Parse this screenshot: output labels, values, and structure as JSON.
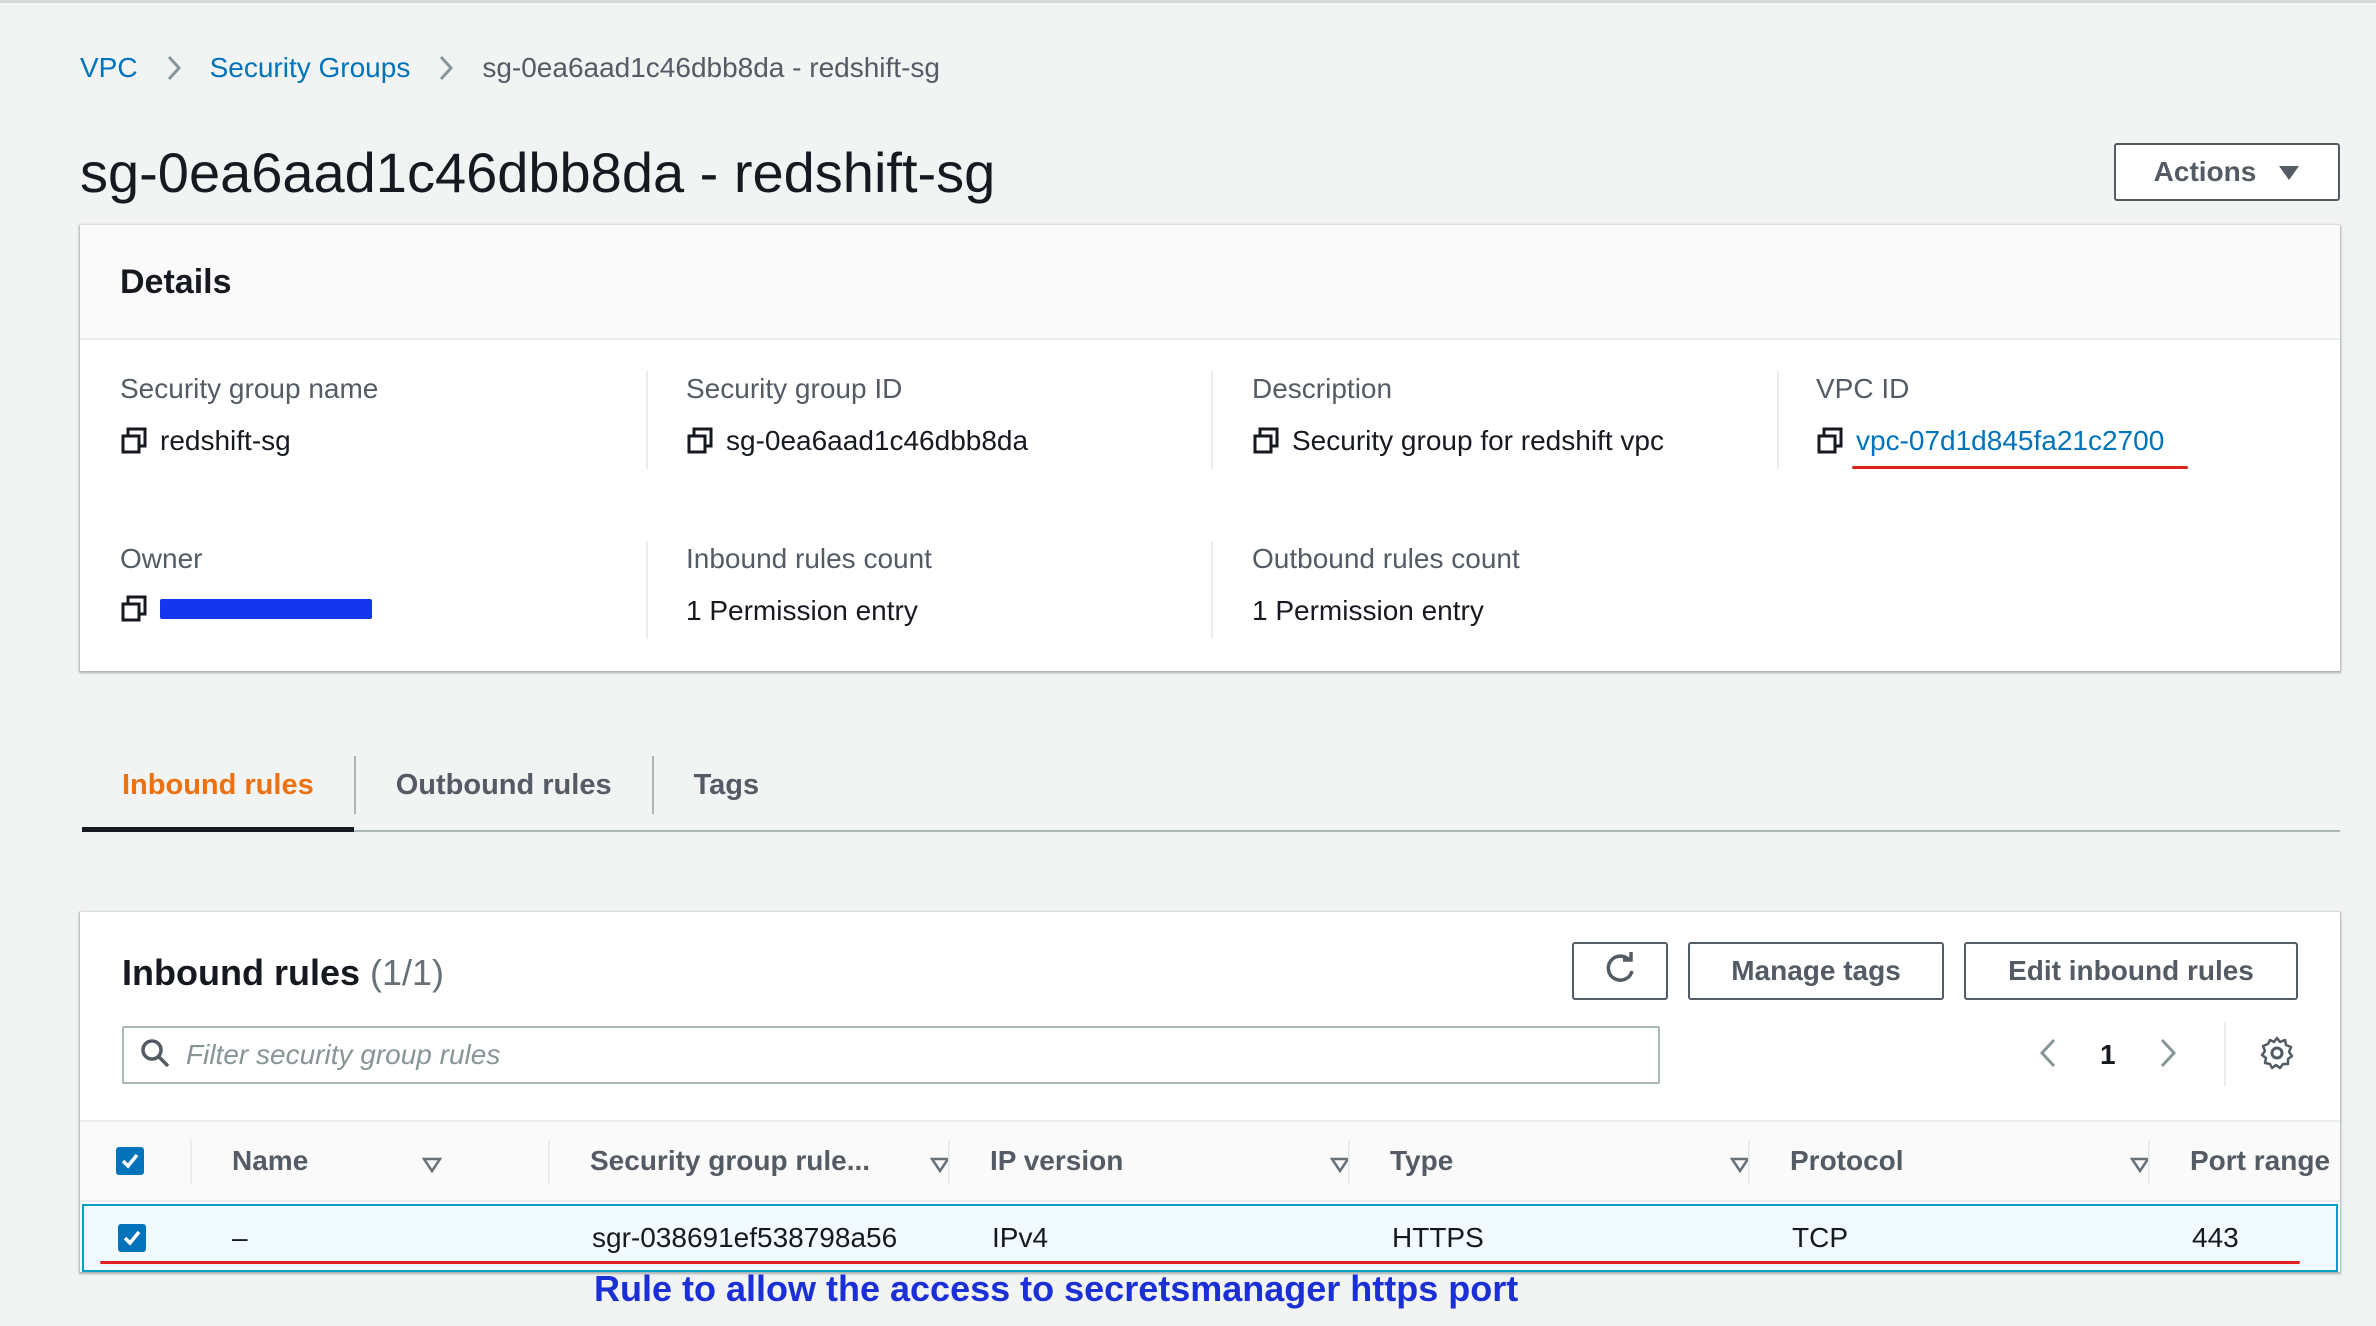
{
  "breadcrumb": {
    "items": [
      "VPC",
      "Security Groups"
    ],
    "current": "sg-0ea6aad1c46dbb8da - redshift-sg"
  },
  "page": {
    "title": "sg-0ea6aad1c46dbb8da - redshift-sg",
    "actions_label": "Actions"
  },
  "details": {
    "header": "Details",
    "fields": {
      "sg_name": {
        "label": "Security group name",
        "value": "redshift-sg"
      },
      "sg_id": {
        "label": "Security group ID",
        "value": "sg-0ea6aad1c46dbb8da"
      },
      "description": {
        "label": "Description",
        "value": "Security group for redshift vpc"
      },
      "vpc_id": {
        "label": "VPC ID",
        "value": "vpc-07d1d845fa21c2700"
      },
      "owner": {
        "label": "Owner",
        "value": "[redacted]"
      },
      "inbound_count": {
        "label": "Inbound rules count",
        "value": "1 Permission entry"
      },
      "outbound_count": {
        "label": "Outbound rules count",
        "value": "1 Permission entry"
      }
    }
  },
  "tabs": [
    "Inbound rules",
    "Outbound rules",
    "Tags"
  ],
  "inbound": {
    "title": "Inbound rules",
    "count": "(1/1)",
    "manage_tags_label": "Manage tags",
    "edit_label": "Edit inbound rules",
    "search_placeholder": "Filter security group rules",
    "page_number": "1",
    "columns": [
      "Name",
      "Security group rule...",
      "IP version",
      "Type",
      "Protocol",
      "Port range"
    ],
    "rows": [
      {
        "name": "–",
        "rule_id": "sgr-038691ef538798a56",
        "ip_version": "IPv4",
        "type": "HTTPS",
        "protocol": "TCP",
        "port_range": "443",
        "selected": true
      }
    ]
  },
  "annotation": "Rule to allow the access to secretsmanager https port",
  "colors": {
    "link": "#0073bb",
    "active_tab": "#ec7211",
    "annotation": "#1a2fd6",
    "underline": "#e0221e",
    "redaction": "#1436ef"
  }
}
